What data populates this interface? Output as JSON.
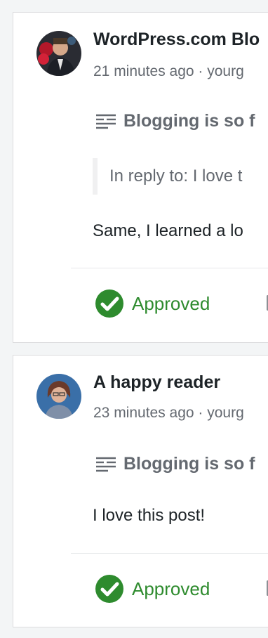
{
  "comments": [
    {
      "author": "WordPress.com Blo",
      "meta": "21 minutes ago · yourg",
      "post_title": "Blogging is so f",
      "reply_to": "In reply to: I love t",
      "text": "Same, I learned a lo",
      "status": "Approved"
    },
    {
      "author": "A happy reader",
      "meta": "23 minutes ago · yourg",
      "post_title": "Blogging is so f",
      "text": "I love this post!",
      "status": "Approved"
    }
  ],
  "colors": {
    "approved": "#2e8b2e",
    "meta": "#646970"
  },
  "icons": {
    "post": "post-lines-icon",
    "approved": "checkmark-circle-icon"
  }
}
